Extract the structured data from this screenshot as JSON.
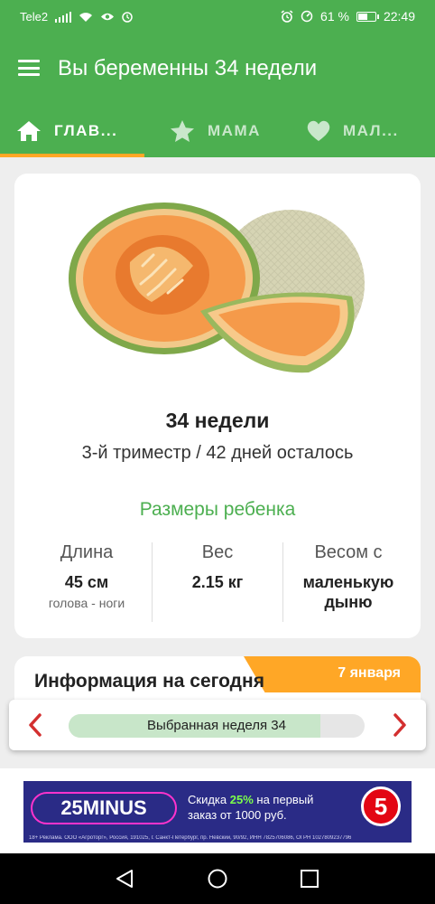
{
  "status_bar": {
    "carrier": "Tele2",
    "battery_percent": "61 %",
    "battery_level": 0.61,
    "time": "22:49"
  },
  "app_bar": {
    "title": "Вы беременны 34 недели"
  },
  "tabs": [
    {
      "label": "ГЛАВ...",
      "icon": "home-icon",
      "active": true
    },
    {
      "label": "МАМА",
      "icon": "star-icon",
      "active": false
    },
    {
      "label": "МАЛ...",
      "icon": "heart-icon",
      "active": false
    }
  ],
  "week_card": {
    "image": "cantaloupe-melon",
    "week_title": "34 недели",
    "trimester_line": "3-й триместр / 42 дней осталось",
    "sizes_link": "Размеры ребенка",
    "stats": {
      "length_label": "Длина",
      "length_value": "45 см",
      "length_note": "голова - ноги",
      "weight_label": "Вес",
      "weight_value": "2.15 кг",
      "size_label": "Весом с",
      "size_value": "маленькую дыню"
    }
  },
  "today_card": {
    "title": "Информация на сегодня",
    "date_badge": "7 января"
  },
  "week_selector": {
    "label": "Выбранная неделя 34",
    "progress": 0.85
  },
  "ad_banner": {
    "brand": "25MINUS",
    "offer_prefix": "Скидка ",
    "offer_discount": "25%",
    "offer_suffix": " на первый",
    "offer_line2": "заказ от 1000 руб.",
    "partner_logo": "5",
    "legal": "18+ Реклама. ООО «Агроторг», Россия, 191025, г. Санкт-Петербург, пр. Невский, 90/92, ИНН 7825706086, ОГРН 1027809237796"
  },
  "colors": {
    "primary": "#4caf50",
    "accent": "#ffa726",
    "link": "#4caf50",
    "arrow": "#d32f2f"
  }
}
